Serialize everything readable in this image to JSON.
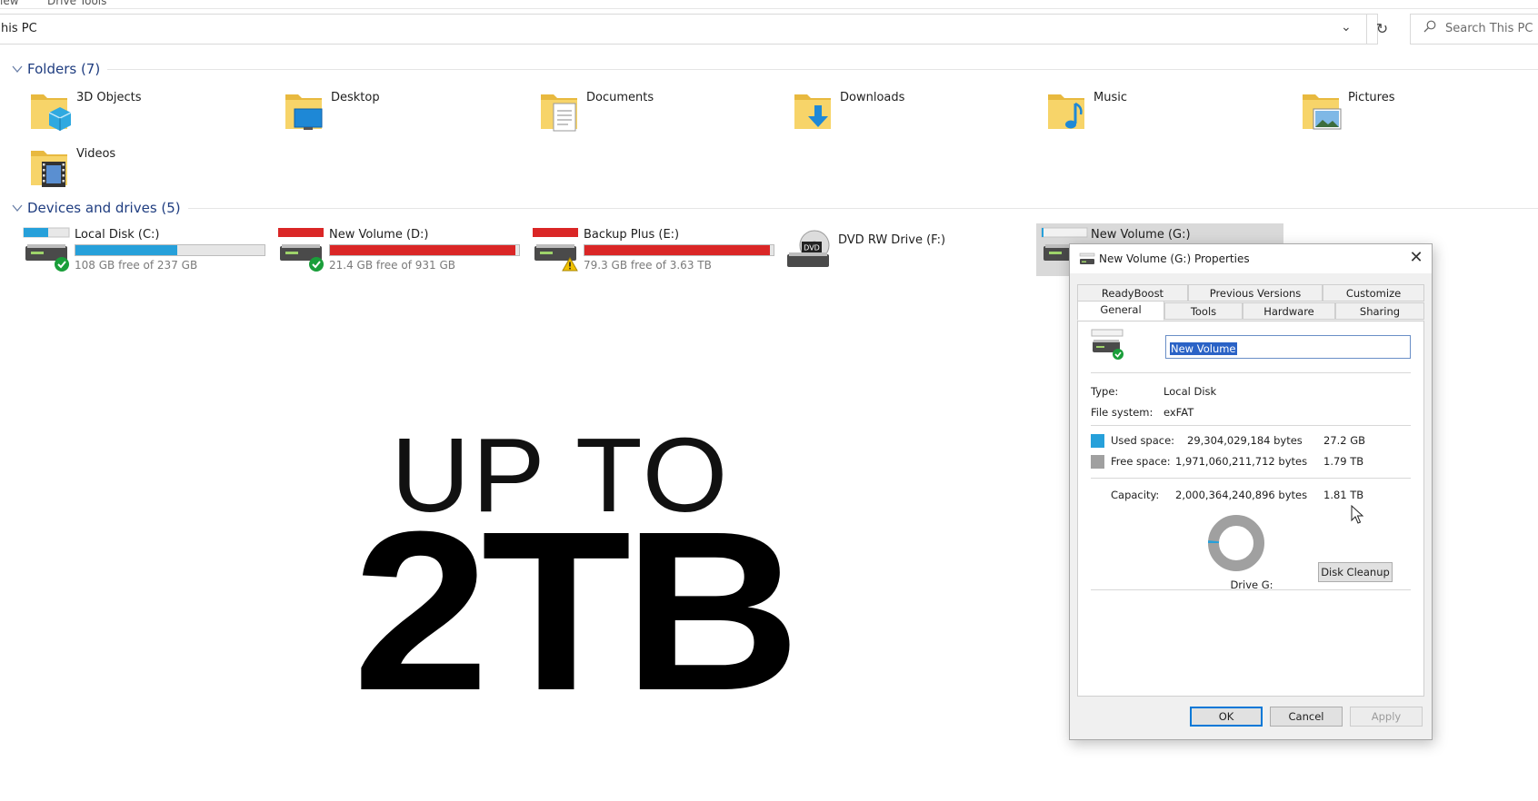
{
  "ribbon": {
    "items": [
      "iew",
      "Drive Tools"
    ]
  },
  "address": {
    "path": "his PC"
  },
  "search": {
    "placeholder": "Search This PC"
  },
  "folders": {
    "title": "Folders (7)",
    "items": [
      {
        "label": "3D Objects",
        "icon": "3d-objects-folder-icon"
      },
      {
        "label": "Desktop",
        "icon": "desktop-folder-icon"
      },
      {
        "label": "Documents",
        "icon": "documents-folder-icon"
      },
      {
        "label": "Downloads",
        "icon": "downloads-folder-icon"
      },
      {
        "label": "Music",
        "icon": "music-folder-icon"
      },
      {
        "label": "Pictures",
        "icon": "pictures-folder-icon"
      },
      {
        "label": "Videos",
        "icon": "videos-folder-icon"
      }
    ]
  },
  "drives": {
    "title": "Devices and drives (5)",
    "items": [
      {
        "label": "Local Disk (C:)",
        "free": "108 GB free of 237 GB",
        "used_fraction": 0.54,
        "bar_color": "#26a0da",
        "status": "ok"
      },
      {
        "label": "New Volume (D:)",
        "free": "21.4 GB free of 931 GB",
        "used_fraction": 0.98,
        "bar_color": "#da2626",
        "status": "ok"
      },
      {
        "label": "Backup Plus (E:)",
        "free": "79.3 GB free of 3.63 TB",
        "used_fraction": 0.98,
        "bar_color": "#da2626",
        "status": "warning"
      },
      {
        "label": "DVD RW Drive (F:)",
        "icon": "dvd-drive-icon"
      },
      {
        "label": "New Volume (G:)"
      }
    ]
  },
  "overlay": {
    "line1": "UP TO",
    "line2": "2TB"
  },
  "dialog": {
    "title": "New Volume (G:) Properties",
    "close": "✕",
    "tabs_top": [
      "ReadyBoost",
      "Previous Versions",
      "Customize"
    ],
    "tabs_bottom": [
      "General",
      "Tools",
      "Hardware",
      "Sharing"
    ],
    "active_tab": "General",
    "volume_name": "New Volume",
    "type_label": "Type:",
    "type_value": "Local Disk",
    "fs_label": "File system:",
    "fs_value": "exFAT",
    "used_label": "Used space:",
    "used_bytes": "29,304,029,184 bytes",
    "used_size": "27.2 GB",
    "used_color": "#26a0da",
    "free_label": "Free space:",
    "free_bytes": "1,971,060,211,712 bytes",
    "free_size": "1.79 TB",
    "free_color": "#a0a0a0",
    "capacity_label": "Capacity:",
    "capacity_bytes": "2,000,364,240,896 bytes",
    "capacity_size": "1.81 TB",
    "used_fraction": 0.015,
    "drive_caption": "Drive G:",
    "disk_cleanup": "Disk Cleanup",
    "ok": "OK",
    "cancel": "Cancel",
    "apply": "Apply"
  }
}
